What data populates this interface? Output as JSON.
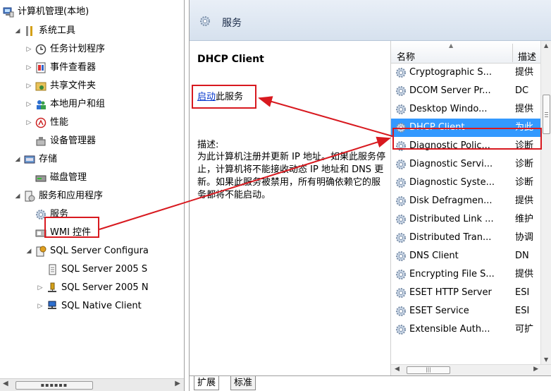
{
  "tree": {
    "root": "计算机管理(本地)",
    "items": [
      {
        "label": "系统工具",
        "icon": "tools-icon"
      },
      {
        "label": "任务计划程序",
        "icon": "clock-icon"
      },
      {
        "label": "事件查看器",
        "icon": "event-viewer-icon"
      },
      {
        "label": "共享文件夹",
        "icon": "shared-folder-icon"
      },
      {
        "label": "本地用户和组",
        "icon": "users-icon"
      },
      {
        "label": "性能",
        "icon": "performance-icon"
      },
      {
        "label": "设备管理器",
        "icon": "device-manager-icon"
      },
      {
        "label": "存储",
        "icon": "storage-icon"
      },
      {
        "label": "磁盘管理",
        "icon": "disk-icon"
      },
      {
        "label": "服务和应用程序",
        "icon": "services-apps-icon"
      },
      {
        "label": "服务",
        "icon": "gear-icon"
      },
      {
        "label": "WMI 控件",
        "icon": "wmi-icon"
      },
      {
        "label": "SQL Server Configura",
        "icon": "sql-config-icon"
      },
      {
        "label": "SQL Server 2005 S",
        "icon": "document-icon"
      },
      {
        "label": "SQL Server 2005 N",
        "icon": "network-icon"
      },
      {
        "label": "SQL Native Client",
        "icon": "client-icon"
      }
    ]
  },
  "header": {
    "title": "服务"
  },
  "detail": {
    "service_name": "DHCP Client",
    "start_link": "启动",
    "start_suffix": "此服务",
    "desc_label": "描述:",
    "desc_text": "为此计算机注册并更新 IP 地址。如果此服务停止，计算机将不能接收动态 IP 地址和 DNS 更新。如果此服务被禁用，所有明确依赖它的服务都将不能启动。"
  },
  "list": {
    "col_name": "名称",
    "col_desc": "描述",
    "rows": [
      {
        "name": "Cryptographic S...",
        "desc": "提供"
      },
      {
        "name": "DCOM Server Pr...",
        "desc": "DC"
      },
      {
        "name": "Desktop Windo...",
        "desc": "提供"
      },
      {
        "name": "DHCP Client",
        "desc": "为此",
        "selected": true
      },
      {
        "name": "Diagnostic Polic...",
        "desc": "诊断"
      },
      {
        "name": "Diagnostic Servi...",
        "desc": "诊断"
      },
      {
        "name": "Diagnostic Syste...",
        "desc": "诊断"
      },
      {
        "name": "Disk Defragmen...",
        "desc": "提供"
      },
      {
        "name": "Distributed Link ...",
        "desc": "维护"
      },
      {
        "name": "Distributed Tran...",
        "desc": "协调"
      },
      {
        "name": "DNS Client",
        "desc": "DN"
      },
      {
        "name": "Encrypting File S...",
        "desc": "提供"
      },
      {
        "name": "ESET HTTP Server",
        "desc": "ESI"
      },
      {
        "name": "ESET Service",
        "desc": "ESI"
      },
      {
        "name": "Extensible Auth...",
        "desc": "可扩"
      }
    ]
  },
  "tabs": {
    "extended": "扩展",
    "standard": "标准"
  },
  "colors": {
    "selection": "#3399ff",
    "annotation": "#d8191f",
    "link": "#0033cc"
  }
}
